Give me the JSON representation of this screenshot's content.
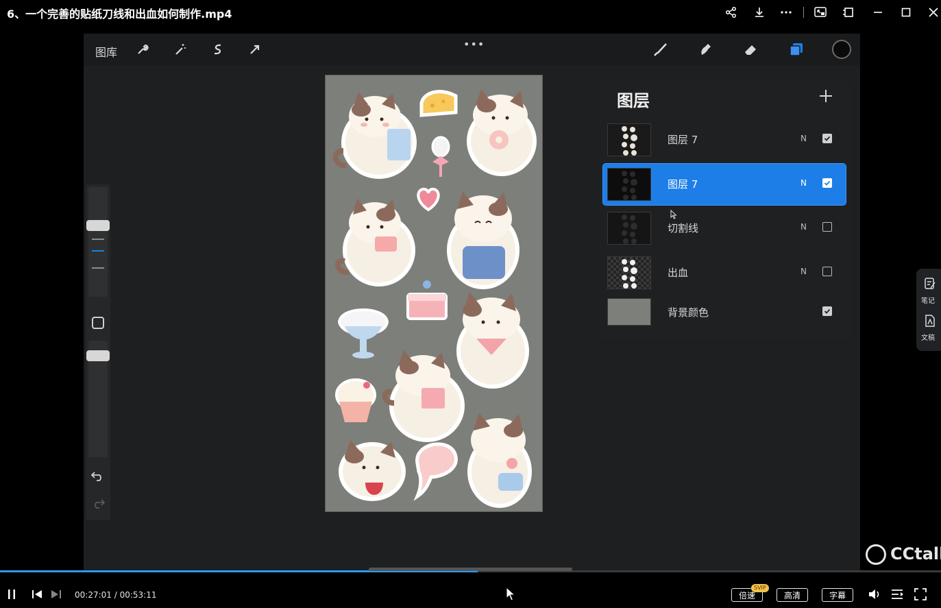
{
  "window": {
    "title": "6、一个完善的贴纸刀线和出血如何制作.mp4"
  },
  "app": {
    "gallery_label": "图库",
    "tools": [
      "wrench-icon",
      "magic-wand-icon",
      "selection-icon",
      "transform-icon"
    ],
    "right_tools": [
      "brush-icon",
      "smudge-icon",
      "eraser-icon",
      "layers-icon"
    ],
    "current_color": "#0a0a0a"
  },
  "layers_panel": {
    "title": "图层",
    "items": [
      {
        "name": "图层 7",
        "mode": "N",
        "visible": true,
        "selected": false
      },
      {
        "name": "图层 7",
        "mode": "N",
        "visible": true,
        "selected": true
      },
      {
        "name": "切割线",
        "mode": "N",
        "visible": false,
        "selected": false
      },
      {
        "name": "出血",
        "mode": "N",
        "visible": false,
        "selected": false
      },
      {
        "name": "背景颜色",
        "mode": "",
        "visible": true,
        "selected": false
      }
    ]
  },
  "side_float": {
    "notes_label": "笔记",
    "doc_label": "文稿"
  },
  "watermark": "CCtalk",
  "player": {
    "time": "00:27:01 / 00:53:11",
    "progress": 0.508,
    "speed_label": "倍速",
    "svip_badge": "SVIP",
    "quality_label": "高清",
    "subtitle_label": "字幕"
  },
  "colors": {
    "accent": "#1e7ee8",
    "progress": "#2a9bf0",
    "canvas_bg": "#7d7f7a"
  }
}
